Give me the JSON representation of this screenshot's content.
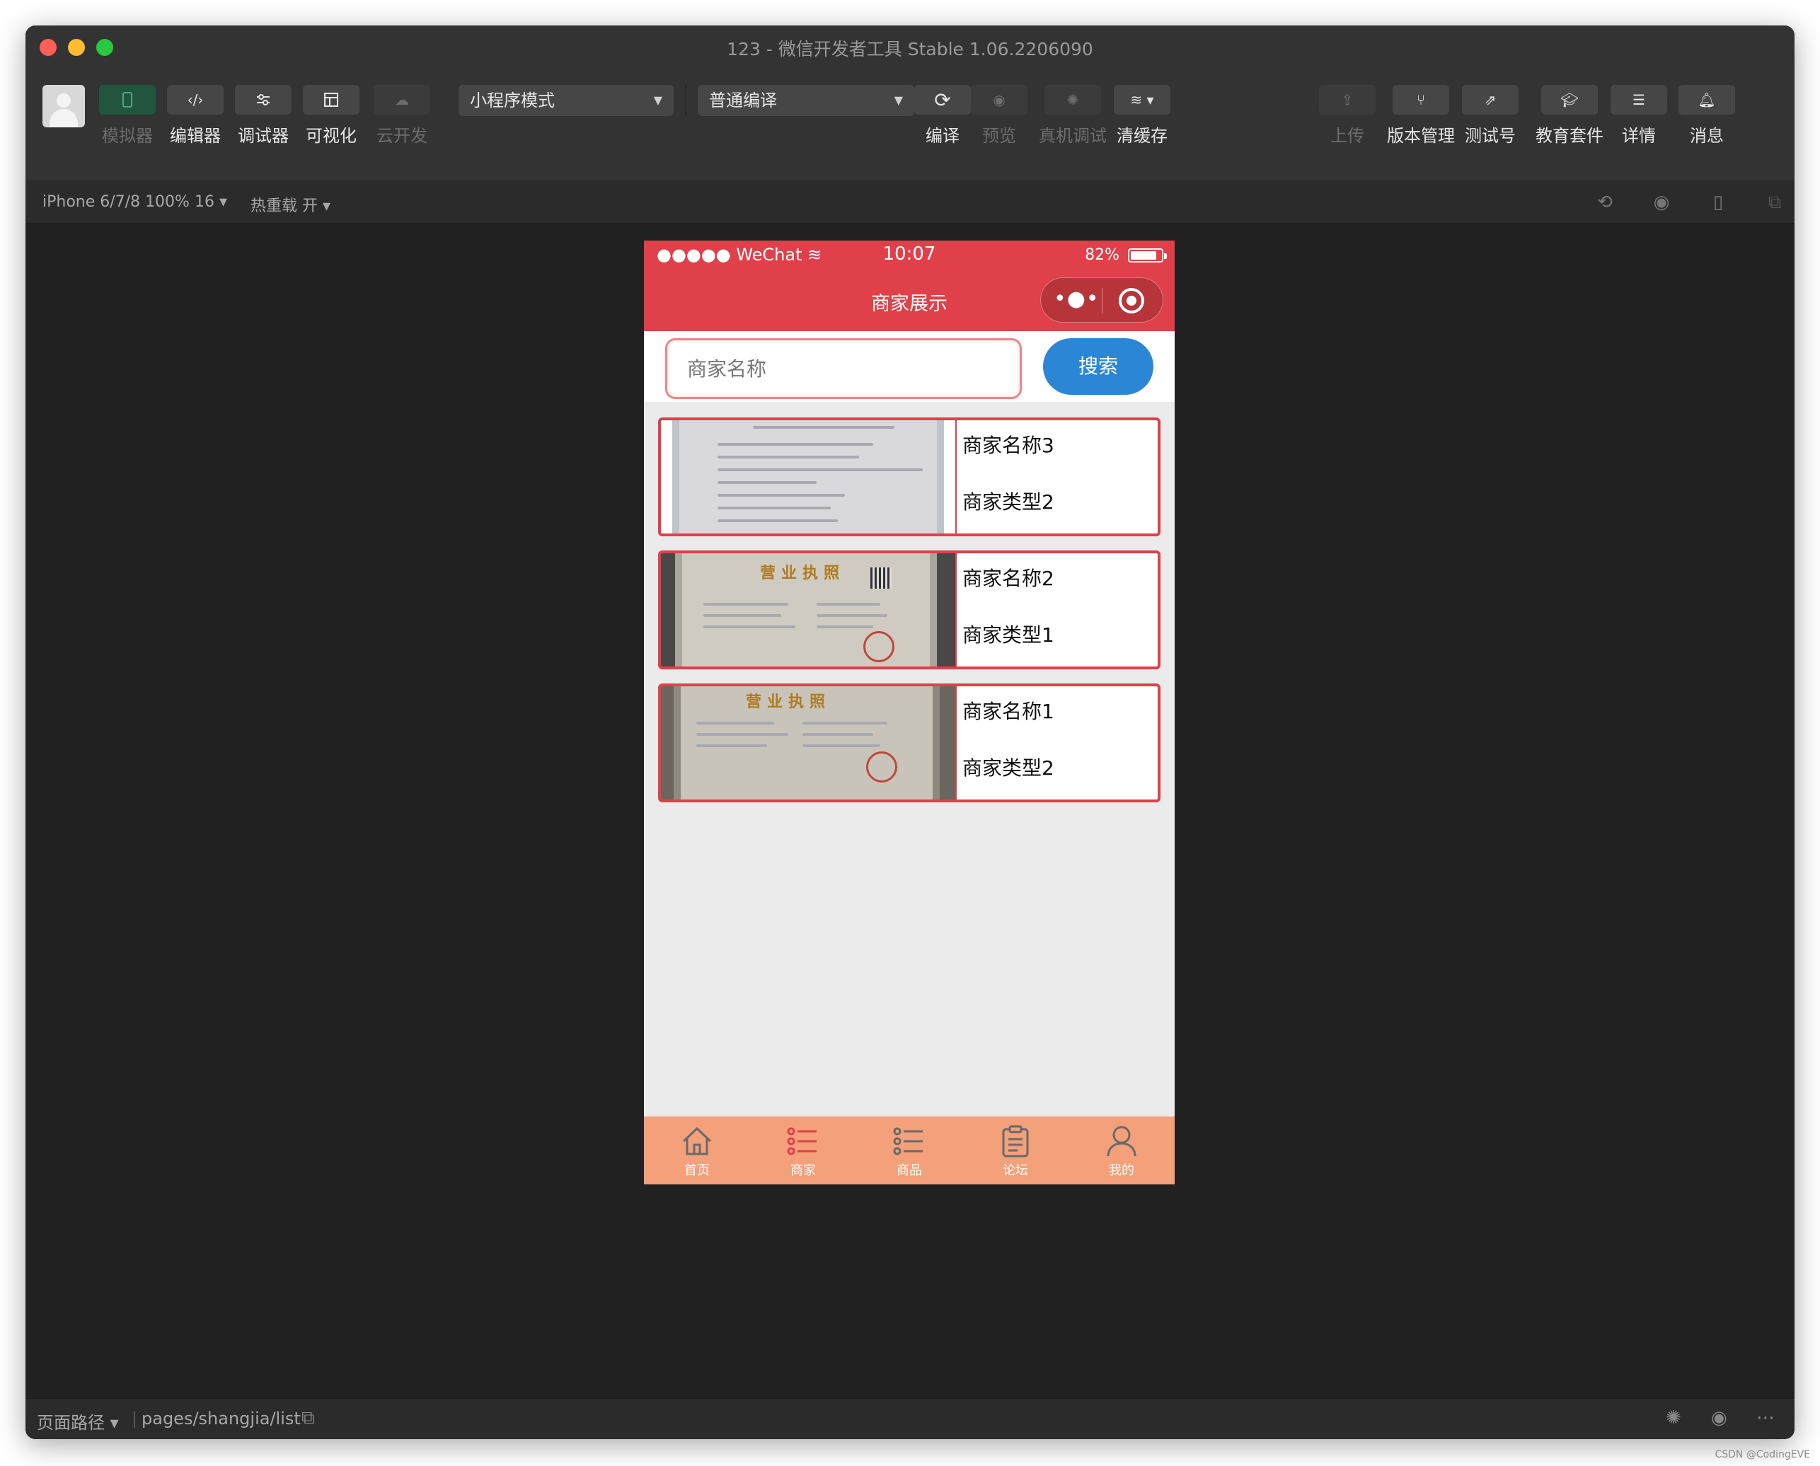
{
  "window": {
    "title": "123 - 微信开发者工具 Stable 1.06.2206090"
  },
  "toolbar": {
    "left_buttons": [
      {
        "label": "模拟器",
        "icon": "phone-icon"
      },
      {
        "label": "编辑器",
        "icon": "code-icon"
      },
      {
        "label": "调试器",
        "icon": "debug-sliders-icon"
      },
      {
        "label": "可视化",
        "icon": "layout-icon"
      },
      {
        "label": "云开发",
        "icon": "cloud-icon"
      }
    ],
    "mode_select": "小程序模式",
    "compile_select": "普通编译",
    "mid_buttons": [
      {
        "label": "编译",
        "icon": "refresh-icon"
      },
      {
        "label": "预览",
        "icon": "eye-icon"
      },
      {
        "label": "真机调试",
        "icon": "bug-icon"
      },
      {
        "label": "清缓存",
        "icon": "layers-icon"
      }
    ],
    "right_buttons": [
      {
        "label": "上传",
        "icon": "upload-icon"
      },
      {
        "label": "版本管理",
        "icon": "branch-icon"
      },
      {
        "label": "测试号",
        "icon": "external-link-icon"
      },
      {
        "label": "教育套件",
        "icon": "graduation-cap-icon"
      },
      {
        "label": "详情",
        "icon": "menu-icon"
      },
      {
        "label": "消息",
        "icon": "bell-icon"
      }
    ]
  },
  "subbar": {
    "device": "iPhone 6/7/8 100% 16",
    "hot_reload": "热重载 开"
  },
  "phone": {
    "status": {
      "carrier": "●●●●● WeChat",
      "time": "10:07",
      "battery": "82%"
    },
    "nav_title": "商家展示",
    "search": {
      "placeholder": "商家名称",
      "button": "搜索"
    },
    "merchants": [
      {
        "name": "商家名称3",
        "type": "商家类型2"
      },
      {
        "name": "商家名称2",
        "type": "商家类型1"
      },
      {
        "name": "商家名称1",
        "type": "商家类型2"
      }
    ],
    "cert_headers": [
      "营业执照",
      "营业执照"
    ],
    "tabs": [
      {
        "label": "首页",
        "icon": "home-icon"
      },
      {
        "label": "商家",
        "icon": "list-icon"
      },
      {
        "label": "商品",
        "icon": "list-icon"
      },
      {
        "label": "论坛",
        "icon": "clipboard-icon"
      },
      {
        "label": "我的",
        "icon": "user-icon"
      }
    ],
    "colors": {
      "primary": "#e04049",
      "tabbar": "#f4a07a",
      "search_button": "#2b86d6",
      "active_tab": "#e04049"
    }
  },
  "bottom": {
    "path_label": "页面路径",
    "path": "pages/shangjia/list"
  },
  "watermark": "CSDN @CodingEVE"
}
